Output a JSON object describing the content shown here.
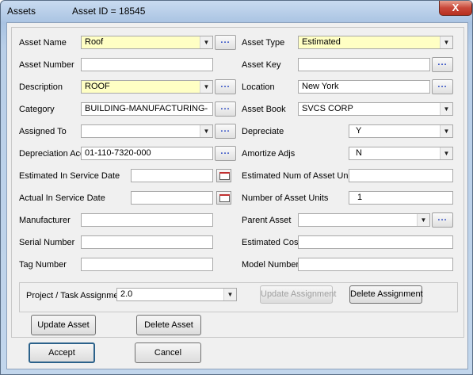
{
  "window": {
    "title": "Assets",
    "asset_id": "Asset ID = 18545",
    "close_glyph": "X"
  },
  "fields": {
    "asset_name": {
      "label": "Asset Name",
      "value": "Roof"
    },
    "asset_type": {
      "label": "Asset Type",
      "value": "Estimated"
    },
    "asset_number": {
      "label": "Asset Number",
      "value": ""
    },
    "asset_key": {
      "label": "Asset Key",
      "value": ""
    },
    "description": {
      "label": "Description",
      "value": "ROOF"
    },
    "location": {
      "label": "Location",
      "value": "New York"
    },
    "category": {
      "label": "Category",
      "value": "BUILDING-MANUFACTURING-"
    },
    "asset_book": {
      "label": "Asset Book",
      "value": "SVCS CORP"
    },
    "assigned_to": {
      "label": "Assigned To",
      "value": ""
    },
    "depreciate": {
      "label": "Depreciate",
      "value": "Y"
    },
    "depreciation_acct": {
      "label": "Depreciation Acct",
      "value": "01-110-7320-000"
    },
    "amortize_adjs": {
      "label": "Amortize Adjs",
      "value": "N"
    },
    "est_in_service_date": {
      "label": "Estimated In Service Date",
      "value": ""
    },
    "est_num_units": {
      "label": "Estimated Num of Asset Units",
      "value": ""
    },
    "actual_in_service_date": {
      "label": "Actual In Service Date",
      "value": ""
    },
    "num_units": {
      "label": "Number of Asset Units",
      "value": "1"
    },
    "manufacturer": {
      "label": "Manufacturer",
      "value": ""
    },
    "parent_asset": {
      "label": "Parent Asset",
      "value": ""
    },
    "serial_number": {
      "label": "Serial Number",
      "value": ""
    },
    "estimated_cost": {
      "label": "Estimated Cost",
      "value": ""
    },
    "tag_number": {
      "label": "Tag Number",
      "value": ""
    },
    "model_number": {
      "label": "Model Number",
      "value": ""
    }
  },
  "assignment": {
    "label": "Project / Task Assignment",
    "value": "2.0",
    "update_label": "Update Assignment",
    "delete_label": "Delete Assignment"
  },
  "buttons": {
    "update_asset": "Update Asset",
    "delete_asset": "Delete Asset",
    "accept": "Accept",
    "cancel": "Cancel"
  },
  "glyphs": {
    "ellipsis": "...",
    "dropdown": "▼"
  },
  "colors": {
    "highlight_field": "#ffffc4",
    "title_bar": "#b9cfe8"
  }
}
